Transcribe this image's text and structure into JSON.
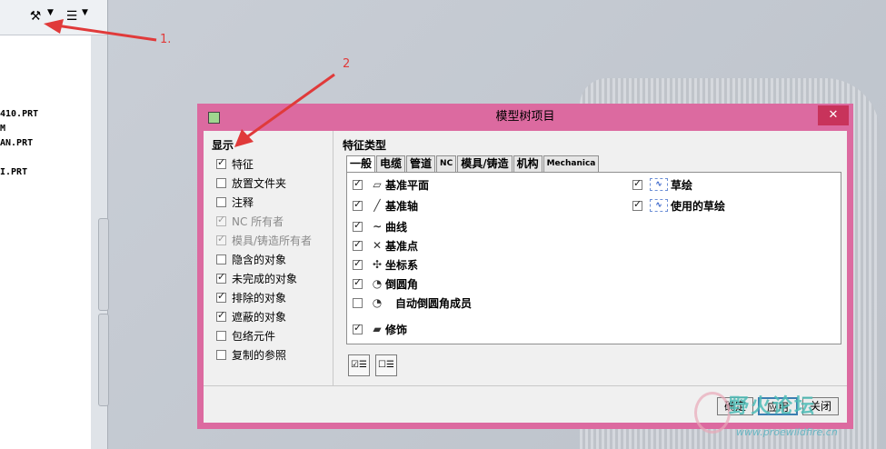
{
  "model_tree": {
    "lines": [
      "410.PRT",
      "M",
      "AN.PRT",
      "I.PRT"
    ]
  },
  "annotations": {
    "label_1": "1.",
    "label_2": "2"
  },
  "dialog": {
    "title": "模型树项目",
    "close_symbol": "✕",
    "show_section": {
      "label": "显示",
      "items": [
        {
          "label": "特征",
          "checked": true,
          "enabled": true
        },
        {
          "label": "放置文件夹",
          "checked": false,
          "enabled": true
        },
        {
          "label": "注释",
          "checked": false,
          "enabled": true
        },
        {
          "label": "NC 所有者",
          "checked": true,
          "enabled": false
        },
        {
          "label": "模具/铸造所有者",
          "checked": true,
          "enabled": false
        },
        {
          "label": "隐含的对象",
          "checked": false,
          "enabled": true
        },
        {
          "label": "未完成的对象",
          "checked": true,
          "enabled": true
        },
        {
          "label": "排除的对象",
          "checked": true,
          "enabled": true
        },
        {
          "label": "遮蔽的对象",
          "checked": true,
          "enabled": true
        },
        {
          "label": "包络元件",
          "checked": false,
          "enabled": true
        },
        {
          "label": "复制的参照",
          "checked": false,
          "enabled": true
        }
      ]
    },
    "feature_types": {
      "label": "特征类型",
      "tabs": [
        "一般",
        "电缆",
        "管道",
        "NC",
        "模具/铸造",
        "机构",
        "Mechanica"
      ],
      "left_items": [
        {
          "label": "基准平面",
          "checked": true,
          "icon": "datum-plane-icon",
          "glyph": "▱"
        },
        {
          "label": "基准轴",
          "checked": true,
          "icon": "datum-axis-icon",
          "glyph": "╱"
        },
        {
          "label": "曲线",
          "checked": true,
          "icon": "curve-icon",
          "glyph": "∼"
        },
        {
          "label": "基准点",
          "checked": true,
          "icon": "datum-point-icon",
          "glyph": "✕"
        },
        {
          "label": "坐标系",
          "checked": true,
          "icon": "coordinate-system-icon",
          "glyph": "✣"
        },
        {
          "label": "倒圆角",
          "checked": true,
          "icon": "round-icon",
          "glyph": "◔"
        },
        {
          "label": "自动倒圆角成员",
          "checked": false,
          "icon": "auto-round-member-icon",
          "glyph": "◔"
        },
        {
          "label": "修饰",
          "checked": true,
          "icon": "cosmetic-icon",
          "glyph": "▰"
        }
      ],
      "right_items": [
        {
          "label": "草绘",
          "checked": true,
          "icon": "sketch-icon",
          "glyph": "∿"
        },
        {
          "label": "使用的草绘",
          "checked": true,
          "icon": "used-sketch-icon",
          "glyph": "∿"
        }
      ],
      "select_all_glyph": "☑☰",
      "deselect_all_glyph": "☐☰"
    },
    "buttons": {
      "ok": "确定",
      "apply": "应用",
      "close": "关闭"
    }
  },
  "watermark": {
    "text": "野火论坛",
    "url": "www.proewildfire.cn"
  },
  "colors": {
    "dialog_frame": "#dc6aa0",
    "close_button": "#c8335b",
    "annotation": "#e03a3a"
  }
}
